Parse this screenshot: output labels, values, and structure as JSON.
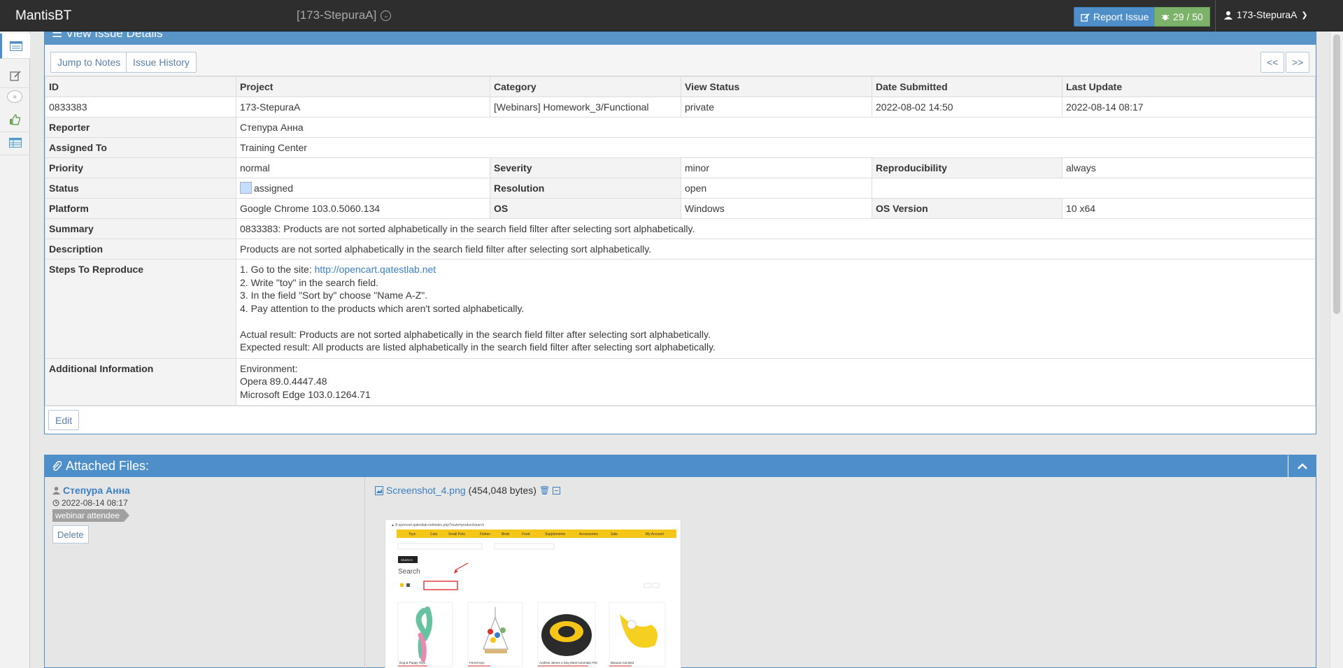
{
  "navbar": {
    "brand": "MantisBT",
    "project": "[173-StepuraA]",
    "report_issue": "Report Issue",
    "issue_count": "29 / 50",
    "user": "173-StepuraA"
  },
  "view_issue": {
    "header": "View Issue Details",
    "jump_to_notes": "Jump to Notes",
    "issue_history": "Issue History",
    "prev": "<<",
    "next": ">>",
    "columns": [
      "ID",
      "Project",
      "Category",
      "View Status",
      "Date Submitted",
      "Last Update"
    ],
    "values": [
      "0833383",
      "173-StepuraA",
      "[Webinars] Homework_3/Functional",
      "private",
      "2022-08-02 14:50",
      "2022-08-14 08:17"
    ],
    "reporter_label": "Reporter",
    "reporter": "Степура Анна",
    "assigned_label": "Assigned To",
    "assigned": "Training Center",
    "priority_label": "Priority",
    "priority": "normal",
    "severity_label": "Severity",
    "severity": "minor",
    "reproducibility_label": "Reproducibility",
    "reproducibility": "always",
    "status_label": "Status",
    "status": "assigned",
    "resolution_label": "Resolution",
    "resolution": "open",
    "platform_label": "Platform",
    "platform": "Google Chrome 103.0.5060.134",
    "os_label": "OS",
    "os": "Windows",
    "os_version_label": "OS Version",
    "os_version": "10 x64",
    "summary_label": "Summary",
    "summary": "0833383: Products are not sorted alphabetically in the search field filter after selecting sort alphabetically.",
    "description_label": "Description",
    "description": "Products are not sorted alphabetically in the search field filter after selecting sort alphabetically.",
    "steps_label": "Steps To Reproduce",
    "steps_prefix": "1. Go to the site: ",
    "steps_link": "http://opencart.qatestlab.net",
    "steps": [
      "2. Write \"toy\" in the search field.",
      "3. In the field \"Sort by\" choose \"Name A-Z\".",
      "4. Pay attention to the products which aren't sorted alphabetically.",
      "",
      "Actual result: Products are not sorted alphabetically in the search field filter after selecting sort alphabetically.",
      "Expected result: All products are listed alphabetically in the search field filter after selecting sort alphabetically."
    ],
    "additional_label": "Additional Information",
    "additional": [
      "Environment:",
      "Opera 89.0.4447.48",
      "Microsoft Edge 103.0.1264.71"
    ],
    "edit": "Edit"
  },
  "attached": {
    "header": "Attached Files:",
    "author": "Степура Анна",
    "date": "2022-08-14 08:17",
    "role": "webinar attendee",
    "delete": "Delete",
    "filename": "Screenshot_4.png",
    "filesize": "(454,048 bytes)"
  },
  "screenshot_thumb": {
    "menu": [
      "Toys",
      "Cats",
      "Small Pets",
      "Fishes",
      "Birds",
      "Food",
      "Supplements",
      "Accessories",
      "Sale",
      "My Account"
    ],
    "search_heading": "Search",
    "search_button": "SEARCH",
    "products": [
      "Dog & Puppy Toys",
      "Ferret toys",
      "Andrew James 4 Day Meal Automatic Pet",
      "Banana Cat Bed"
    ],
    "colors": {
      "nav_yellow": "#f5c518",
      "accent_red": "#e03030"
    }
  }
}
